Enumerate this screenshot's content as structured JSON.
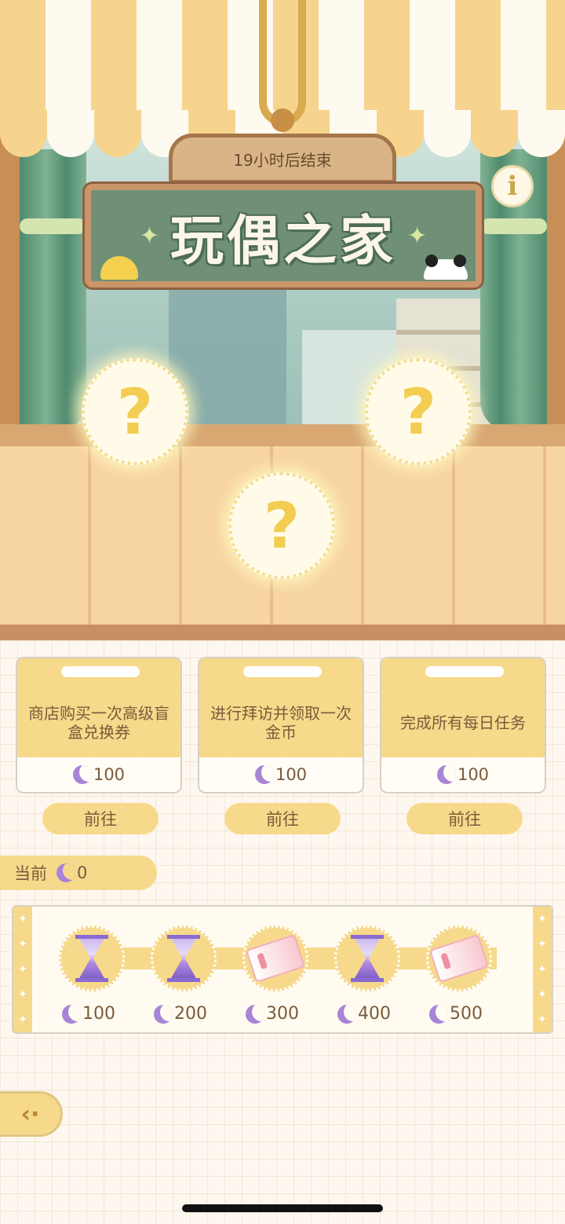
{
  "header": {
    "countdown": "19小时后结束",
    "title": "玩偶之家",
    "info_label": "i"
  },
  "mystery_slots": [
    {
      "label": "?"
    },
    {
      "label": "?"
    },
    {
      "label": "?"
    }
  ],
  "tasks": [
    {
      "description": "商店购买一次高级盲盒兑换券",
      "reward": "100",
      "button": "前往"
    },
    {
      "description": "进行拜访并领取一次金币",
      "reward": "100",
      "button": "前往"
    },
    {
      "description": "完成所有每日任务",
      "reward": "100",
      "button": "前往"
    }
  ],
  "current": {
    "label": "当前",
    "value": "0"
  },
  "milestones": [
    {
      "item": "hourglass-icon",
      "threshold": "100"
    },
    {
      "item": "hourglass-icon",
      "threshold": "200"
    },
    {
      "item": "ticket-icon",
      "threshold": "300"
    },
    {
      "item": "hourglass-icon",
      "threshold": "400"
    },
    {
      "item": "ticket-icon",
      "threshold": "500"
    }
  ],
  "colors": {
    "accent_yellow": "#f7d98b",
    "text_brown": "#7b5a3b",
    "moon_purple": "#a884d6",
    "sign_green": "#6f9076"
  }
}
